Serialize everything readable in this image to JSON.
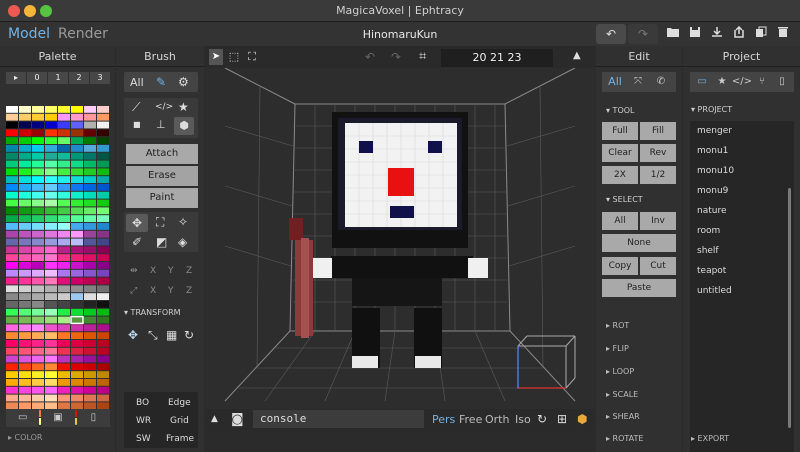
{
  "window": {
    "title": "MagicaVoxel | Ephtracy"
  },
  "topbar": {
    "mode_model": "Model",
    "mode_render": "Render",
    "scene_name": "HinomaruKun",
    "undo_icon": "undo-icon",
    "redo_icon": "redo-icon",
    "file_icons": [
      "folder-open-icon",
      "save-icon",
      "download-icon",
      "export-icon",
      "copy-icon",
      "trash-icon"
    ]
  },
  "palette": {
    "title": "Palette",
    "tabs": [
      "▸",
      "0",
      "1",
      "2",
      "3"
    ],
    "footer": "▸ COLOR",
    "selected_color_index": 221,
    "colors": [
      "#ffffff",
      "#ffffcc",
      "#ffff99",
      "#ffff66",
      "#ffff33",
      "#ffff00",
      "#ffccff",
      "#ffcccc",
      "#ffcc99",
      "#ffcc66",
      "#ffcc33",
      "#ffcc00",
      "#ff99ff",
      "#ff99cc",
      "#ff9999",
      "#ff9966",
      "#000000",
      "#00004f",
      "#000080",
      "#0000cc",
      "#3c3cff",
      "#6060ff",
      "#b0b0b0",
      "#f0f0f0",
      "#ff0000",
      "#cc0000",
      "#990000",
      "#ff3300",
      "#cc3300",
      "#993300",
      "#660000",
      "#330000",
      "#00aa00",
      "#00cc00",
      "#00ff00",
      "#33ff33",
      "#66ff66",
      "#00aa55",
      "#007a00",
      "#004400",
      "#0088aa",
      "#00aacc",
      "#00ccee",
      "#33aadd",
      "#0066aa",
      "#2288cc",
      "#55aadd",
      "#3399cc",
      "#008866",
      "#00aa88",
      "#00ccaa",
      "#22aa99",
      "#11bb99",
      "#009977",
      "#007766",
      "#005544",
      "#00cc77",
      "#00ee99",
      "#22ff99",
      "#55ffaa",
      "#33ee88",
      "#11dd88",
      "#00bb66",
      "#009955",
      "#00dd00",
      "#22ee22",
      "#55ff55",
      "#88ff88",
      "#44ee44",
      "#33dd33",
      "#22cc22",
      "#11bb11",
      "#00bbbb",
      "#00dddd",
      "#00ffff",
      "#33ffff",
      "#22eeee",
      "#11dddd",
      "#00cccc",
      "#00aaaa",
      "#0088ff",
      "#22aaff",
      "#44bbff",
      "#66ccff",
      "#3399ff",
      "#1177ee",
      "#0066dd",
      "#0055cc",
      "#00ffcc",
      "#22ffdd",
      "#44ffee",
      "#66ffee",
      "#33ffdd",
      "#11eecc",
      "#00ddbb",
      "#00ccaa",
      "#44ff44",
      "#66ff66",
      "#88ff88",
      "#aaffaa",
      "#55ff55",
      "#33ee33",
      "#22dd22",
      "#11cc11",
      "#008800",
      "#119911",
      "#22aa22",
      "#33bb33",
      "#44cc44",
      "#55dd55",
      "#66ee66",
      "#77ff77",
      "#00aa44",
      "#11bb55",
      "#22cc66",
      "#33dd77",
      "#44ee88",
      "#55ff99",
      "#66ffaa",
      "#77ffbb",
      "#55bbff",
      "#66ccff",
      "#77ddff",
      "#88eeff",
      "#99ffff",
      "#44aaee",
      "#3399dd",
      "#2288cc",
      "#aa44aa",
      "#bb55bb",
      "#cc66cc",
      "#dd77dd",
      "#ee88ee",
      "#ff99ff",
      "#994499",
      "#883388",
      "#6666aa",
      "#7777bb",
      "#8888cc",
      "#9999dd",
      "#aaaaee",
      "#bbbbff",
      "#555599",
      "#444488",
      "#cc3399",
      "#dd44aa",
      "#ee55bb",
      "#ff66cc",
      "#bb2288",
      "#aa1177",
      "#991166",
      "#880055",
      "#ff4499",
      "#ff55aa",
      "#ff66bb",
      "#ff77cc",
      "#ff3388",
      "#ee2277",
      "#dd1166",
      "#cc0055",
      "#ff00ff",
      "#dd00dd",
      "#bb00bb",
      "#ff33ff",
      "#ee22ee",
      "#cc11cc",
      "#aa00aa",
      "#880088",
      "#bb88ff",
      "#cc99ff",
      "#ddaaff",
      "#eebbff",
      "#aa77ee",
      "#9966dd",
      "#8855cc",
      "#7744bb",
      "#ee2288",
      "#ff3399",
      "#ff55aa",
      "#ff77bb",
      "#dd1177",
      "#cc0066",
      "#bb0055",
      "#aa0044",
      "#e0e0e0",
      "#d0d0d0",
      "#c0c0c0",
      "#b0b0b0",
      "#a0a0a0",
      "#909090",
      "#808080",
      "#707070",
      "#888888",
      "#999999",
      "#aaaaaa",
      "#bbbbbb",
      "#cccccc",
      "#9fc8ee",
      "#dddddd",
      "#eeeeee",
      "#666666",
      "#777777",
      "#888888",
      "#555555",
      "#444444",
      "#333333",
      "#222222",
      "#111111",
      "#33ff55",
      "#55ff77",
      "#77ff99",
      "#99ffbb",
      "#22ee44",
      "#11dd33",
      "#00cc22",
      "#00bb11",
      "#66aa44",
      "#77bb55",
      "#88cc66",
      "#99dd77",
      "#aaee88",
      "#55993a",
      "#448833",
      "#337722",
      "#ff66dd",
      "#ff77ee",
      "#ff88ff",
      "#ee55cc",
      "#dd44bb",
      "#cc33aa",
      "#bb2299",
      "#aa1188",
      "#ff8833",
      "#ff9944",
      "#ffaa55",
      "#ffbb66",
      "#ff7722",
      "#ee6611",
      "#dd5500",
      "#cc4400",
      "#ff0066",
      "#ff1177",
      "#ff2288",
      "#ff3399",
      "#ee0055",
      "#dd0044",
      "#cc0033",
      "#bb0022",
      "#ff4466",
      "#ff5577",
      "#ff6688",
      "#ff7799",
      "#ee3355",
      "#dd2244",
      "#cc1133",
      "#bb0022",
      "#cc44cc",
      "#dd55dd",
      "#ee66ee",
      "#ff77ff",
      "#bb33bb",
      "#aa22aa",
      "#991199",
      "#880088",
      "#ff2200",
      "#ff4411",
      "#ff6622",
      "#ff8833",
      "#ee1100",
      "#dd0000",
      "#cc0000",
      "#aa0000",
      "#ffcc00",
      "#ffdd11",
      "#ffee22",
      "#ffff33",
      "#eebb00",
      "#ddaa00",
      "#cc9900",
      "#bb8800",
      "#ffaa00",
      "#ffbb22",
      "#ffcc44",
      "#ffdd66",
      "#ee9900",
      "#dd8800",
      "#cc7700",
      "#bb6600",
      "#ff33cc",
      "#ff44dd",
      "#ff55ee",
      "#ff66ff",
      "#ee22bb",
      "#dd11aa",
      "#cc0099",
      "#bb0088",
      "#ffaa88",
      "#ffbb99",
      "#ffccaa",
      "#ffddbb",
      "#ff9977",
      "#ee8866",
      "#dd7755",
      "#cc6644",
      "#ee8855",
      "#ff9966",
      "#ffaa77",
      "#ffbb88",
      "#dd7744",
      "#cc6633",
      "#bb5522",
      "#aa4411",
      "#ff3300",
      "#ff5522",
      "#ff7744",
      "#ff9966",
      "#ee2200",
      "#dd1100",
      "#cc0000",
      "#bb0000",
      "#ffee66",
      "#ffff77",
      "#ffff88",
      "#ffff99",
      "#eedd55",
      "#ddcc44",
      "#ccbb33",
      "#bbaa22"
    ]
  },
  "brush": {
    "title": "Brush",
    "all_label": "All",
    "attach_label": "Attach",
    "erase_label": "Erase",
    "paint_label": "Paint",
    "transform_label": "▾ TRANSFORM",
    "axis_labels": [
      "X",
      "Y",
      "Z"
    ],
    "bottom": [
      {
        "left": "BO",
        "right": "Edge"
      },
      {
        "left": "WR",
        "right": "Grid"
      },
      {
        "left": "SW",
        "right": "Frame"
      }
    ]
  },
  "viewport": {
    "coords": "20  21  23",
    "console_text": "console",
    "view_modes": [
      "Pers",
      "Free",
      "Orth",
      "Iso"
    ],
    "active_view_mode": "Pers",
    "bg_color": "#2d2d2d",
    "grid_color": "#6a6a6a"
  },
  "edit": {
    "title": "Edit",
    "all_label": "All",
    "tool_label": "▾ TOOL",
    "tool_buttons": [
      [
        "Full",
        "Fill"
      ],
      [
        "Clear",
        "Rev"
      ],
      [
        "2X",
        "1/2"
      ]
    ],
    "select_label": "▾ SELECT",
    "select_buttons": [
      [
        "All",
        "Inv"
      ]
    ],
    "none_label": "None",
    "copy_buttons": [
      [
        "Copy",
        "Cut"
      ]
    ],
    "paste_label": "Paste",
    "collapsed": [
      "▸ ROT",
      "▸ FLIP",
      "▸ LOOP",
      "▸ SCALE",
      "▸ SHEAR",
      "▸ ROTATE"
    ]
  },
  "project": {
    "title": "Project",
    "section_label": "▾ PROJECT",
    "items": [
      "menger",
      "monu1",
      "monu10",
      "monu9",
      "nature",
      "room",
      "shelf",
      "teapot",
      "untitled"
    ],
    "footer": "▸ EXPORT"
  }
}
